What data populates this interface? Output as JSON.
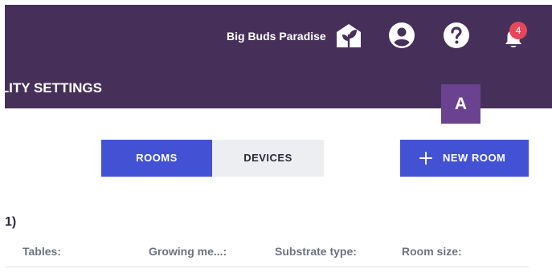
{
  "header": {
    "farm_name": "Big Buds Paradise",
    "notification_count": "4",
    "page_title": "ILITY SETTINGS",
    "icons": [
      "plant-house-icon",
      "account-circle-icon",
      "help-circle-icon",
      "bell-icon"
    ],
    "bg_color": "#463059",
    "badge_color": "#e8465a"
  },
  "avatar": {
    "initial": "A",
    "color": "#6b4290"
  },
  "tabs": [
    {
      "label": "ROOMS",
      "active": true
    },
    {
      "label": "DEVICES",
      "active": false
    }
  ],
  "actions": {
    "new_room_label": "NEW ROOM",
    "accent_color": "#4352d4"
  },
  "section": {
    "title": "1)"
  },
  "table": {
    "columns": [
      "Tables:",
      "Growing me...:",
      "Substrate type:",
      "Room size:"
    ]
  }
}
